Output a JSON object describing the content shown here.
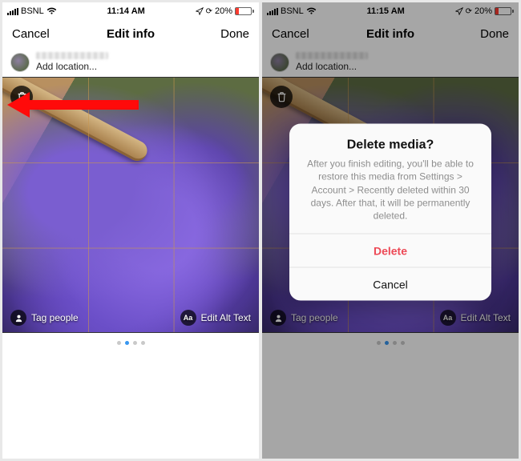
{
  "left": {
    "status": {
      "carrier": "BSNL",
      "time": "11:14 AM",
      "battery": "20%"
    },
    "nav": {
      "cancel": "Cancel",
      "title": "Edit info",
      "done": "Done"
    },
    "add_location": "Add location...",
    "trash_icon": "trash-icon",
    "tag_people": "Tag people",
    "alt_text": "Edit Alt Text",
    "alt_badge": "Aa",
    "dots": {
      "count": 4,
      "active_index": 1
    }
  },
  "right": {
    "status": {
      "carrier": "BSNL",
      "time": "11:15 AM",
      "battery": "20%"
    },
    "nav": {
      "cancel": "Cancel",
      "title": "Edit info",
      "done": "Done"
    },
    "add_location": "Add location...",
    "tag_people": "Tag people",
    "alt_text": "Edit Alt Text",
    "alt_badge": "Aa",
    "dots": {
      "count": 4,
      "active_index": 1
    },
    "dialog": {
      "title": "Delete media?",
      "message": "After you finish editing, you'll be able to restore this media from Settings > Account > Recently deleted within 30 days. After that, it will be permanently deleted.",
      "delete": "Delete",
      "cancel": "Cancel"
    }
  }
}
